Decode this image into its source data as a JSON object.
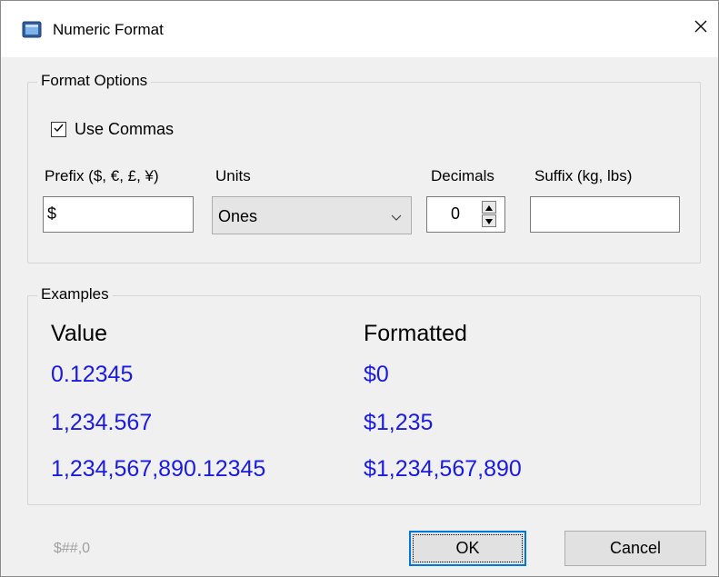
{
  "window": {
    "title": "Numeric Format"
  },
  "format_options": {
    "legend": "Format Options",
    "use_commas": {
      "label": "Use Commas",
      "checked": true
    },
    "prefix": {
      "label": "Prefix ($, €, £, ¥)",
      "value": "$"
    },
    "units": {
      "label": "Units",
      "value": "Ones"
    },
    "decimals": {
      "label": "Decimals",
      "value": "0"
    },
    "suffix": {
      "label": "Suffix (kg, lbs)",
      "value": ""
    }
  },
  "examples": {
    "legend": "Examples",
    "value_header": "Value",
    "formatted_header": "Formatted",
    "rows": [
      {
        "value": "0.12345",
        "formatted": "$0"
      },
      {
        "value": "1,234.567",
        "formatted": "$1,235"
      },
      {
        "value": "1,234,567,890.12345",
        "formatted": "$1,234,567,890"
      }
    ]
  },
  "footer": {
    "format_string": "$##,0",
    "ok_label": "OK",
    "cancel_label": "Cancel"
  },
  "colors": {
    "example_value": "#1a1ae6",
    "ok_border": "#0078d7"
  }
}
